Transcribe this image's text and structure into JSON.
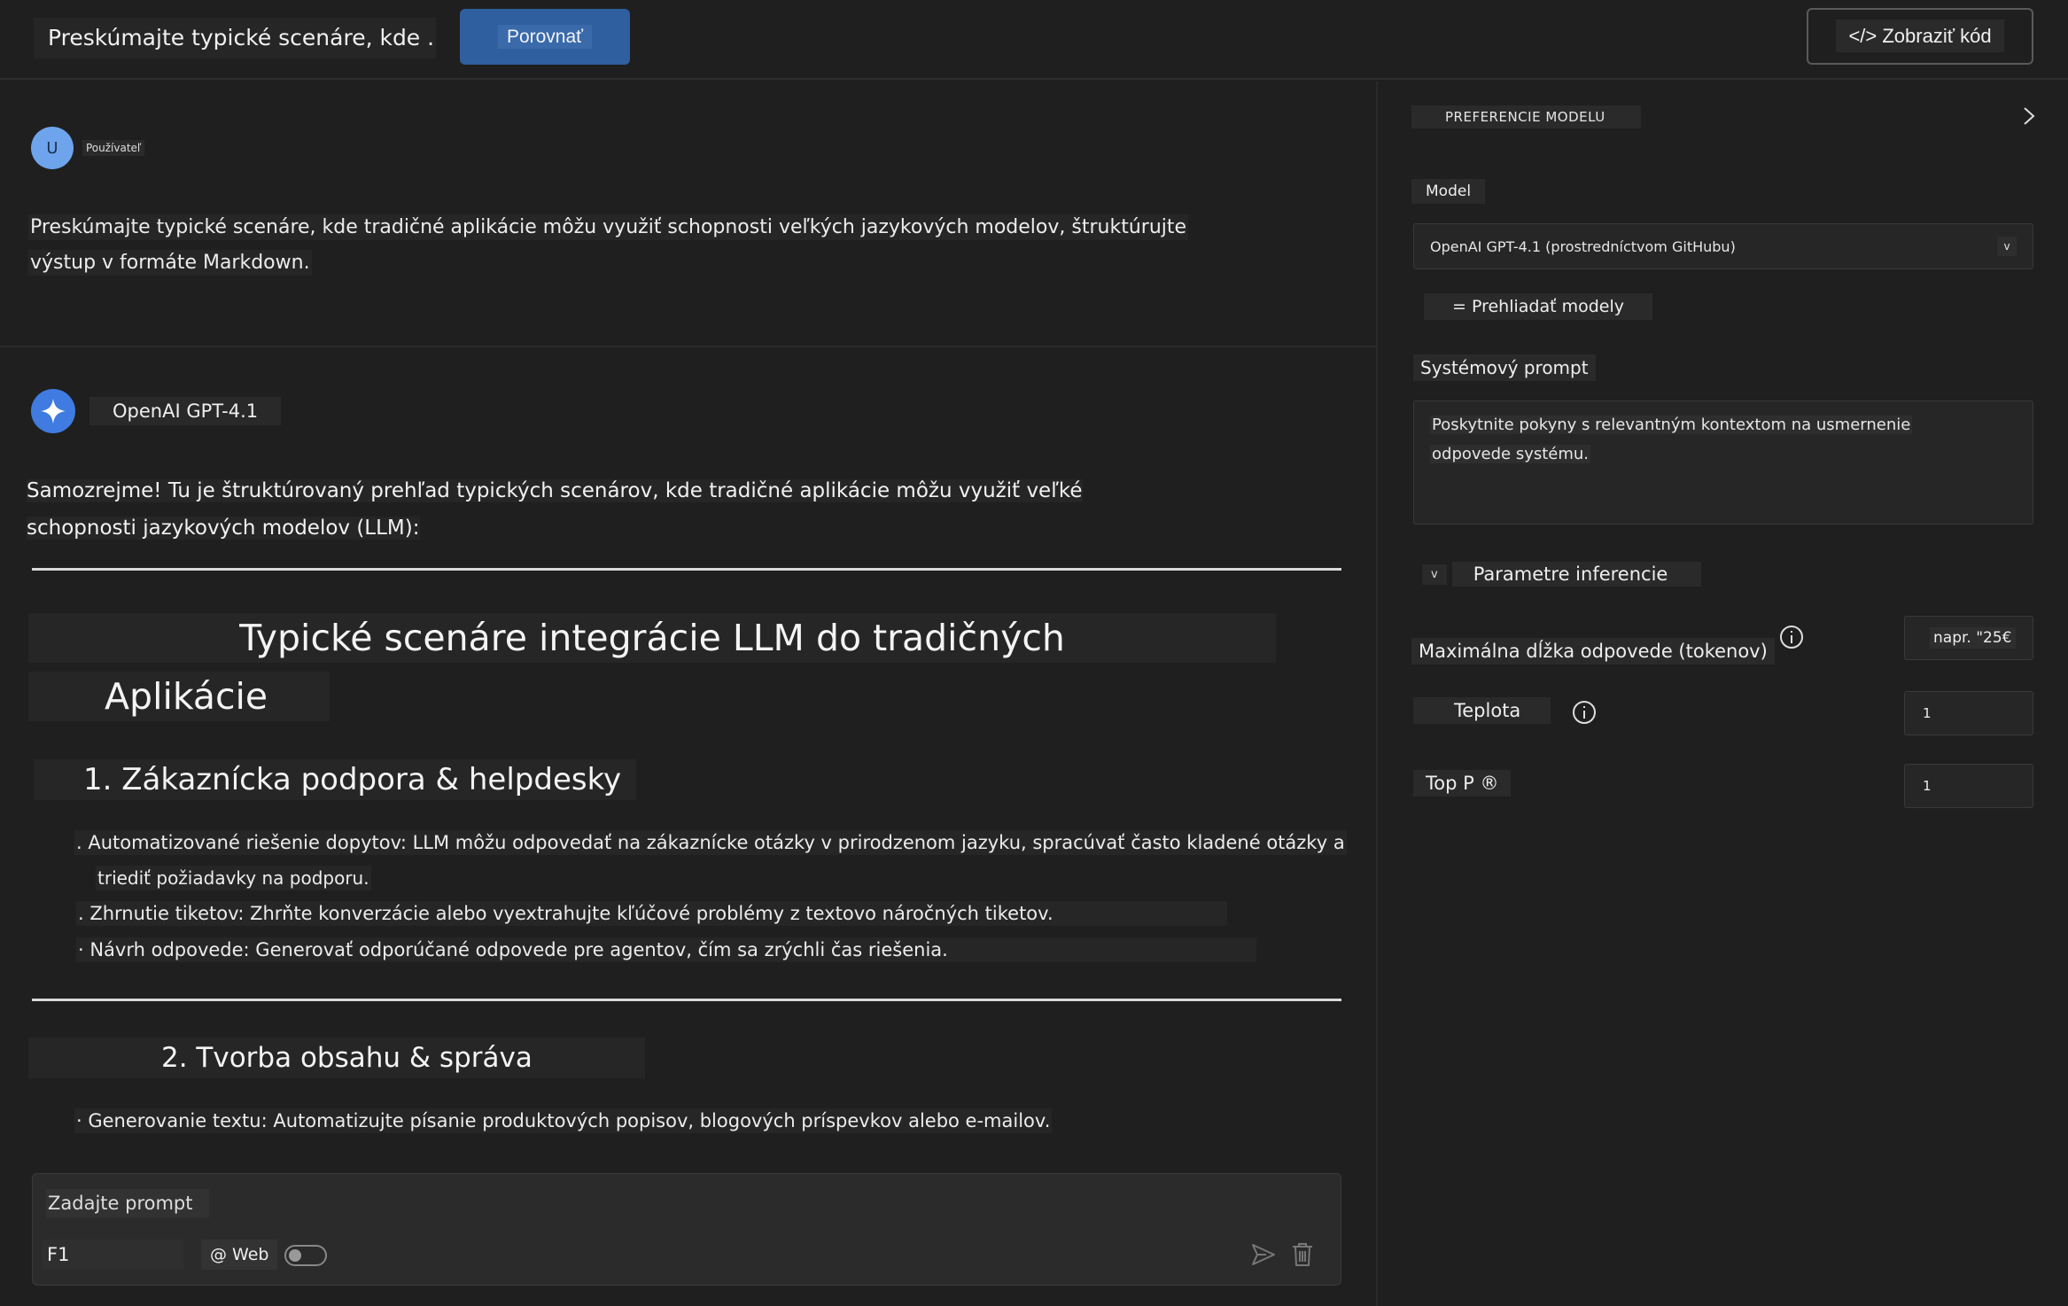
{
  "header": {
    "title": "Preskúmajte typické scenáre, kde ...",
    "compare_label": "Porovnať",
    "code_label": "</> Zobraziť kód"
  },
  "chat": {
    "user_initial": "U",
    "user_label": "Používateľ",
    "user_message_line1": "Preskúmajte typické scenáre, kde tradičné aplikácie môžu využiť schopnosti veľkých jazykových modelov, štruktúrujte",
    "user_message_line2": "výstup v formáte Markdown.",
    "bot_name": "OpenAI GPT-4.1",
    "bot_intro_line1": "Samozrejme! Tu je štruktúrovaný prehľad typických scenárov, kde tradičné aplikácie môžu využiť veľké",
    "bot_intro_line2": "schopnosti jazykových modelov (LLM):",
    "heading_line1": "Typické scenáre integrácie LLM do tradičných",
    "heading_line2": "Aplikácie",
    "section1_title": "1. Zákaznícka podpora & helpdesky",
    "section1_items": [
      ". Automatizované riešenie dopytov: LLM môžu odpovedať na zákaznícke otázky v prirodzenom jazyku, spracúvať často kladené otázky a",
      "triediť požiadavky na podporu.",
      ". Zhrnutie tiketov: Zhrňte konverzácie alebo vyextrahujte kľúčové problémy z textovo náročných tiketov.",
      "· Návrh odpovede: Generovať odporúčané odpovede pre agentov, čím sa zrýchli čas riešenia."
    ],
    "section2_title": "2. Tvorba obsahu & správa",
    "section2_items": [
      "· Generovanie textu: Automatizujte písanie produktových popisov, blogových príspevkov alebo e-mailov."
    ]
  },
  "composer": {
    "placeholder": "Zadajte prompt",
    "f1_value": "F1",
    "web_label": "@ Web",
    "web_enabled": false,
    "send_icon": "send-icon",
    "trash_icon": "trash-icon"
  },
  "panel": {
    "title": "PREFERENCIE MODELU",
    "model_label": "Model",
    "model_value": "OpenAI GPT-4.1 (prostredníctvom GitHubu)",
    "model_caret": "v",
    "browse_label": "= Prehliadať modely",
    "system_prompt_label": "Systémový prompt",
    "system_prompt_line1": "Poskytnite pokyny s relevantným kontextom na usmernenie",
    "system_prompt_line2": "odpovede systému.",
    "params_caret": "v",
    "params_title": "Parametre inferencie",
    "max_tokens_label": "Maximálna dĺžka odpovede (tokenov)",
    "max_tokens_placeholder": "napr. \"25€",
    "temperature_label": "Teplota",
    "temperature_value": "1",
    "top_p_label": "Top P ®",
    "top_p_value": "1"
  },
  "colors": {
    "background": "#1f1f1f",
    "accent": "#2f5f9e",
    "avatar": "#6ea4ec",
    "bot_icon": "#3f7be0"
  }
}
